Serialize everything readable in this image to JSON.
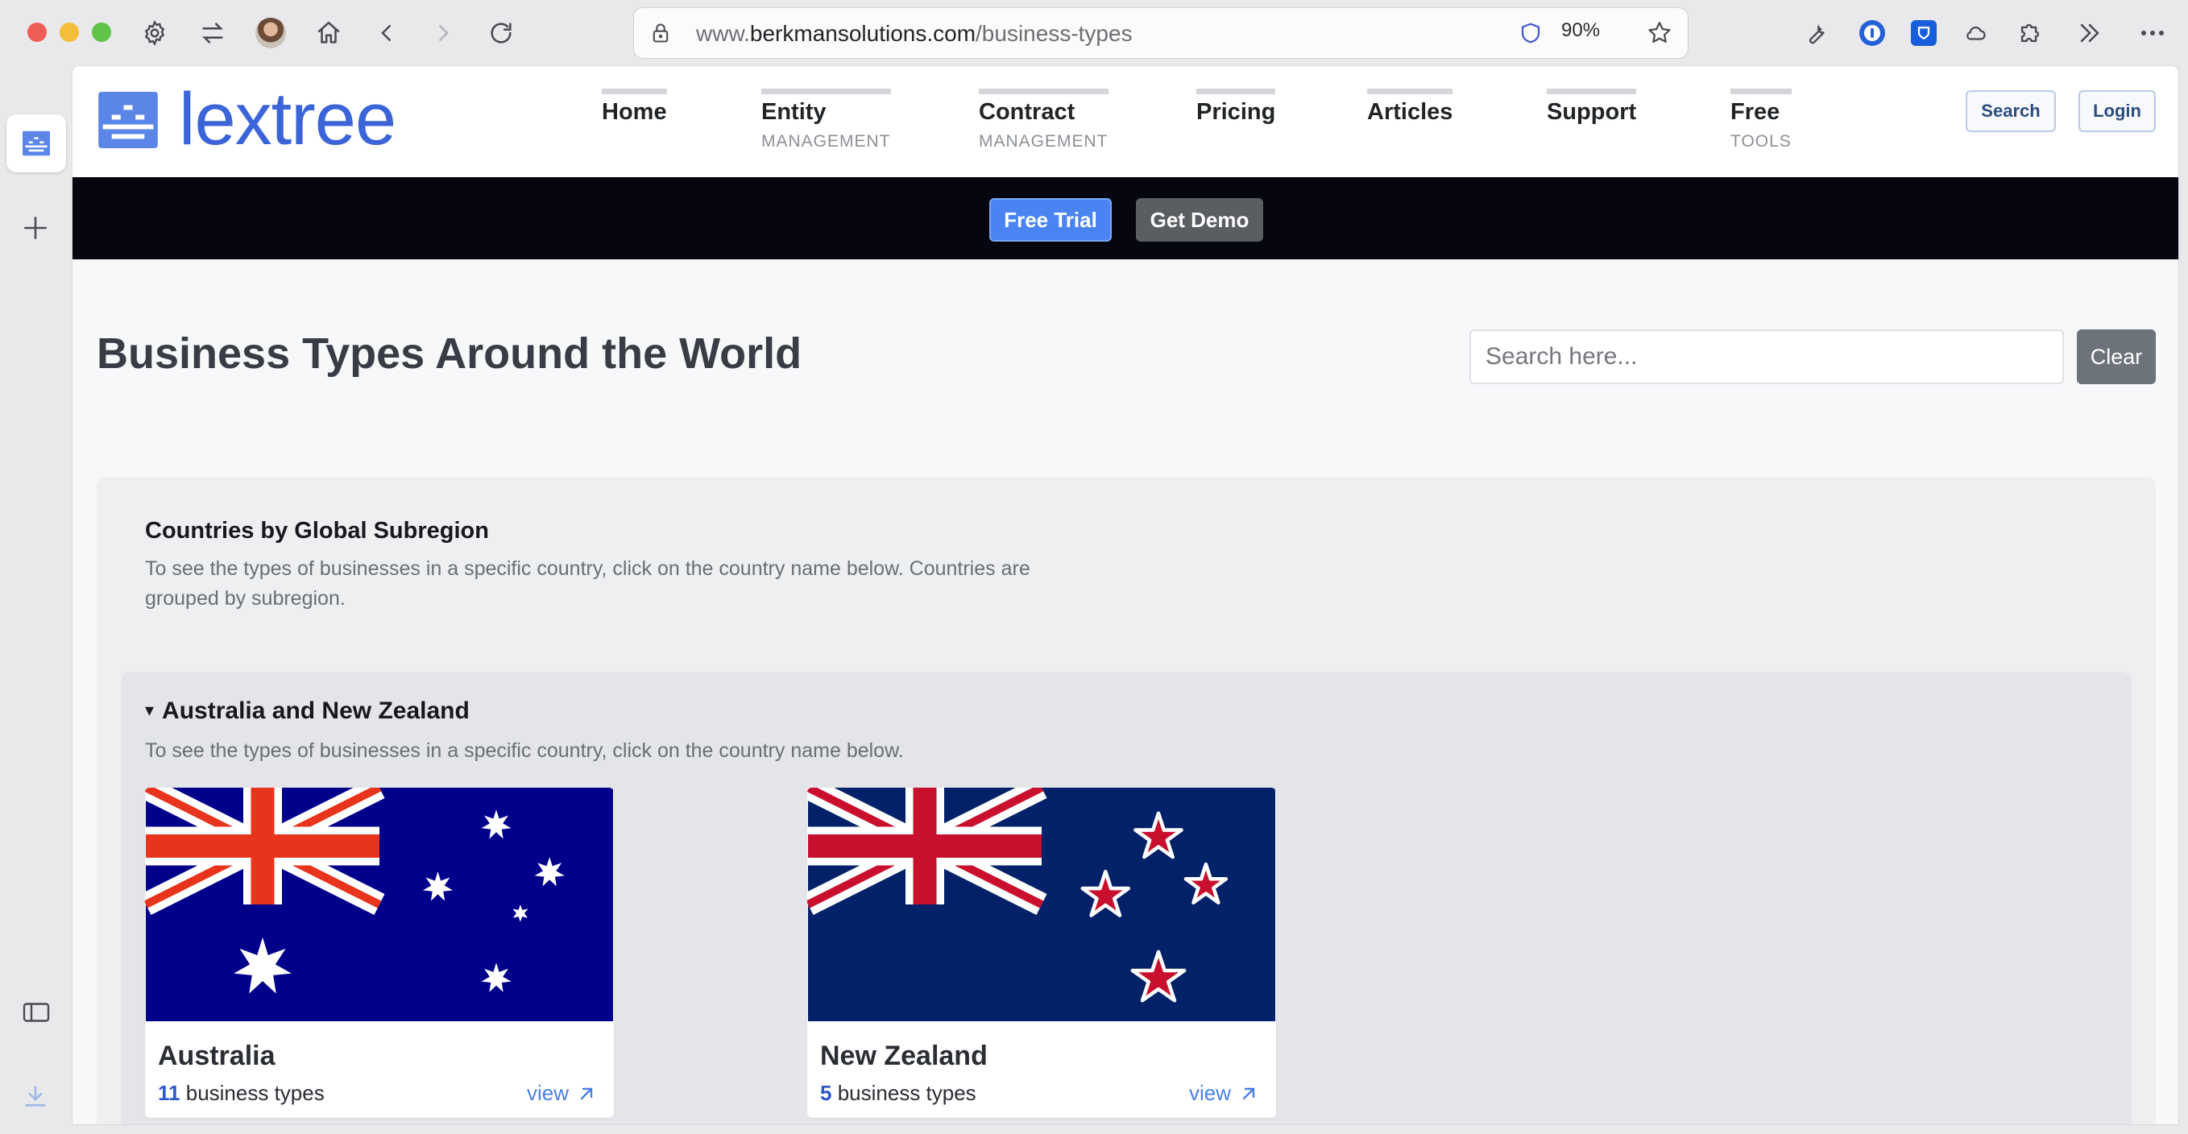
{
  "browser": {
    "url_prefix": "www.",
    "url_domain": "berkmansolutions.com",
    "url_path": "/business-types",
    "zoom": "90%"
  },
  "site": {
    "logo_text": "lextree",
    "nav": [
      {
        "label": "Home",
        "sub": ""
      },
      {
        "label": "Entity",
        "sub": "MANAGEMENT"
      },
      {
        "label": "Contract",
        "sub": "MANAGEMENT"
      },
      {
        "label": "Pricing",
        "sub": ""
      },
      {
        "label": "Articles",
        "sub": ""
      },
      {
        "label": "Support",
        "sub": ""
      },
      {
        "label": "Free",
        "sub": "TOOLS"
      }
    ],
    "search_button": "Search",
    "login_button": "Login",
    "free_trial": "Free Trial",
    "get_demo": "Get Demo"
  },
  "main": {
    "title": "Business Types Around the World",
    "search_placeholder": "Search here...",
    "clear_button": "Clear",
    "panel_title": "Countries by Global Subregion",
    "panel_desc": "To see the types of businesses in a specific country, click on the country name below. Countries are grouped by subregion.",
    "region": {
      "toggle": "▾",
      "title": "Australia and New Zealand",
      "desc": "To see the types of businesses in a specific country, click on the country name below.",
      "countries": [
        {
          "name": "Australia",
          "count": "11",
          "count_label": "business types",
          "view": "view"
        },
        {
          "name": "New Zealand",
          "count": "5",
          "count_label": "business types",
          "view": "view"
        }
      ]
    }
  },
  "colors": {
    "accent": "#3a64d8",
    "banner": "#05060f",
    "flag_au_blue": "#00008b",
    "flag_nz_blue": "#012169",
    "flag_red": "#e8341c"
  }
}
